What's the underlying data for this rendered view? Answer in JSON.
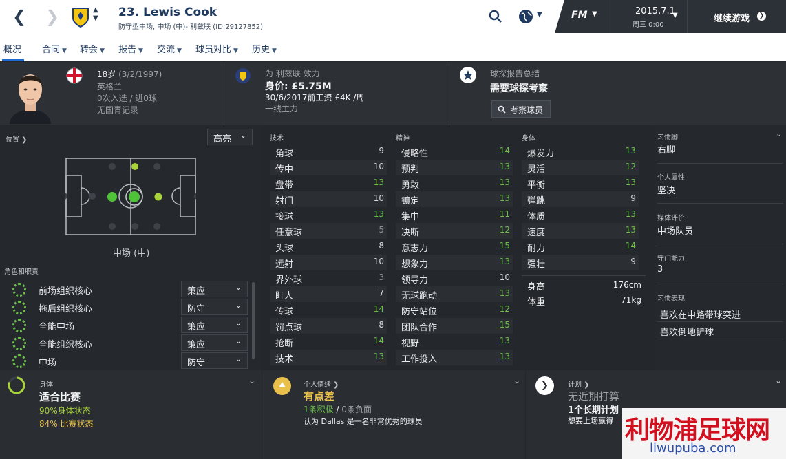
{
  "header": {
    "player_name": "23. Lewis Cook",
    "subtitle": "防守型中场, 中场 (中)- 利兹联 (ID:29127852)",
    "date": "2015.7.1",
    "day_time": "周三 0:00",
    "continue_label": "继续游戏",
    "fm_label": "FM"
  },
  "tabs": [
    {
      "label": "概况"
    },
    {
      "label": "合同"
    },
    {
      "label": "转会"
    },
    {
      "label": "报告"
    },
    {
      "label": "交流"
    },
    {
      "label": "球员对比"
    },
    {
      "label": "历史"
    }
  ],
  "profile": {
    "age": "18岁",
    "dob": "(3/2/1997)",
    "nation": "英格兰",
    "caps": "0次入选 / 进0球",
    "youth": "无国青记录",
    "club_line": "为 利兹联 效力",
    "value": "身价: £5.75M",
    "contract": "30/6/2017前工资 £4K /周",
    "status": "一线主力",
    "scout_title": "球探报告总结",
    "scout_value": "需要球探考察",
    "scout_button": "考察球员"
  },
  "position": {
    "title": "位置",
    "dropdown": "高亮",
    "label": "中场 (中)"
  },
  "roles": {
    "title": "角色和职责",
    "items": [
      {
        "name": "前场组织核心",
        "duty": "策应"
      },
      {
        "name": "拖后组织核心",
        "duty": "防守"
      },
      {
        "name": "全能中场",
        "duty": "策应"
      },
      {
        "name": "全能组织核心",
        "duty": "策应"
      },
      {
        "name": "中场",
        "duty": "防守"
      }
    ]
  },
  "technical": {
    "title": "技术",
    "attrs": [
      {
        "name": "角球",
        "value": "9"
      },
      {
        "name": "传中",
        "value": "10"
      },
      {
        "name": "盘带",
        "value": "13"
      },
      {
        "name": "射门",
        "value": "10"
      },
      {
        "name": "接球",
        "value": "13"
      },
      {
        "name": "任意球",
        "value": "5"
      },
      {
        "name": "头球",
        "value": "8"
      },
      {
        "name": "远射",
        "value": "10"
      },
      {
        "name": "界外球",
        "value": "3"
      },
      {
        "name": "盯人",
        "value": "7"
      },
      {
        "name": "传球",
        "value": "14"
      },
      {
        "name": "罚点球",
        "value": "8"
      },
      {
        "name": "抢断",
        "value": "14"
      },
      {
        "name": "技术",
        "value": "13"
      }
    ]
  },
  "mental": {
    "title": "精神",
    "attrs": [
      {
        "name": "侵略性",
        "value": "14"
      },
      {
        "name": "预判",
        "value": "13"
      },
      {
        "name": "勇敢",
        "value": "13"
      },
      {
        "name": "镇定",
        "value": "13"
      },
      {
        "name": "集中",
        "value": "11"
      },
      {
        "name": "决断",
        "value": "12"
      },
      {
        "name": "意志力",
        "value": "15"
      },
      {
        "name": "想象力",
        "value": "13"
      },
      {
        "name": "领导力",
        "value": "10"
      },
      {
        "name": "无球跑动",
        "value": "13"
      },
      {
        "name": "防守站位",
        "value": "12"
      },
      {
        "name": "团队合作",
        "value": "15"
      },
      {
        "name": "视野",
        "value": "13"
      },
      {
        "name": "工作投入",
        "value": "13"
      }
    ]
  },
  "physical": {
    "title": "身体",
    "attrs": [
      {
        "name": "爆发力",
        "value": "13"
      },
      {
        "name": "灵活",
        "value": "12"
      },
      {
        "name": "平衡",
        "value": "13"
      },
      {
        "name": "弹跳",
        "value": "9"
      },
      {
        "name": "体质",
        "value": "13"
      },
      {
        "name": "速度",
        "value": "13"
      },
      {
        "name": "耐力",
        "value": "14"
      },
      {
        "name": "强壮",
        "value": "9"
      }
    ],
    "height_label": "身高",
    "height": "176cm",
    "weight_label": "体重",
    "weight": "71kg"
  },
  "info": {
    "foot_label": "习惯脚",
    "foot": "右脚",
    "personality_label": "个人属性",
    "personality": "坚决",
    "media_label": "媒体评价",
    "media": "中场队员",
    "gk_label": "守门能力",
    "gk": "3",
    "traits_label": "习惯表现",
    "traits": [
      "喜欢在中路带球突进",
      "喜欢倒地铲球"
    ]
  },
  "condition": {
    "title": "身体",
    "value": "适合比赛",
    "physical": "90%身体状态",
    "match": "84% 比赛状态"
  },
  "morale": {
    "title": "个人情绪",
    "value": "有点差",
    "positive": "1条积极",
    "slash": "/",
    "negative": "0条负面",
    "note": "认为 Dallas 是一名非常优秀的球员"
  },
  "plans": {
    "title": "计划",
    "value": "无近期打算",
    "plan": "1个长期计划",
    "plan_note": "想要上场赢得"
  },
  "watermark": {
    "text": "利物浦足球网",
    "url": "liwupuba.com"
  },
  "colors": {
    "accent": "#1e6bd6",
    "good": "#6cc04a",
    "warn": "#e8c04a",
    "panel": "#25282c"
  }
}
